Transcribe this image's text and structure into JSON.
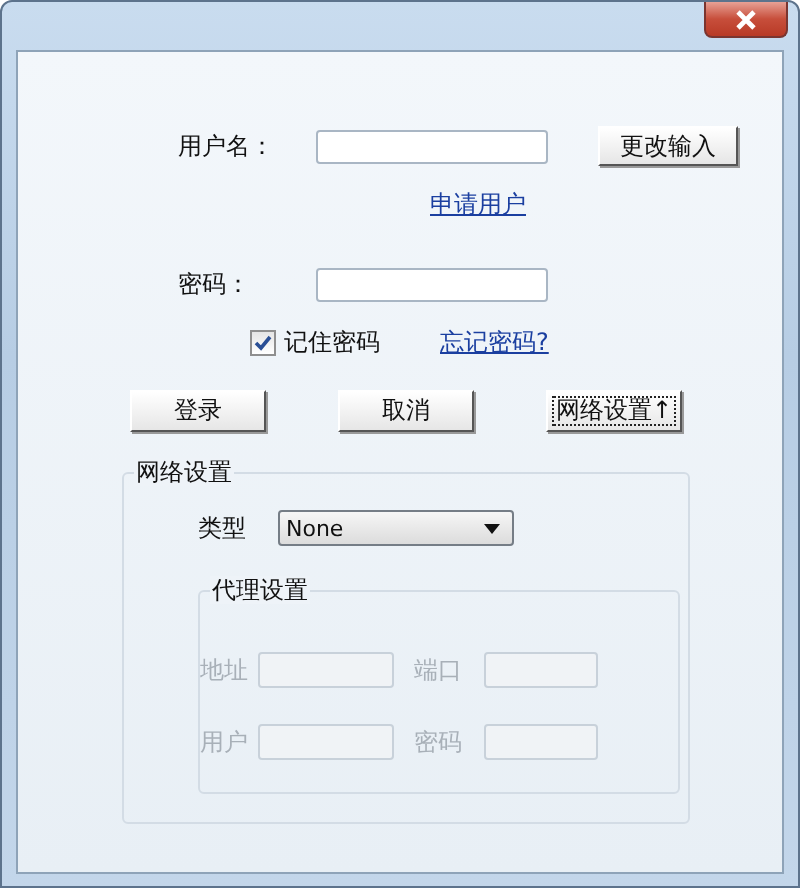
{
  "login": {
    "username": {
      "label": "用户名：",
      "disabled": false
    },
    "change_button": "更改输入",
    "register_link": "申请用户",
    "password": {
      "label": "密码：",
      "disabled": false
    },
    "remember": {
      "label": "记住密码",
      "checked": true
    },
    "forgot_link": "忘记密码?"
  },
  "buttons": [
    {
      "label": "登录",
      "focused": false
    },
    {
      "label": "取消",
      "focused": false
    },
    {
      "label": "网络设置↑",
      "focused": true
    }
  ],
  "network": {
    "title": "网络设置",
    "type_label": "类型",
    "type_value": "None",
    "proxy": {
      "title": "代理设置",
      "fields": [
        {
          "label": "地址",
          "disabled": true
        },
        {
          "label": "端口",
          "disabled": true
        },
        {
          "label": "用户",
          "disabled": true
        },
        {
          "label": "密码",
          "disabled": true
        }
      ]
    }
  }
}
